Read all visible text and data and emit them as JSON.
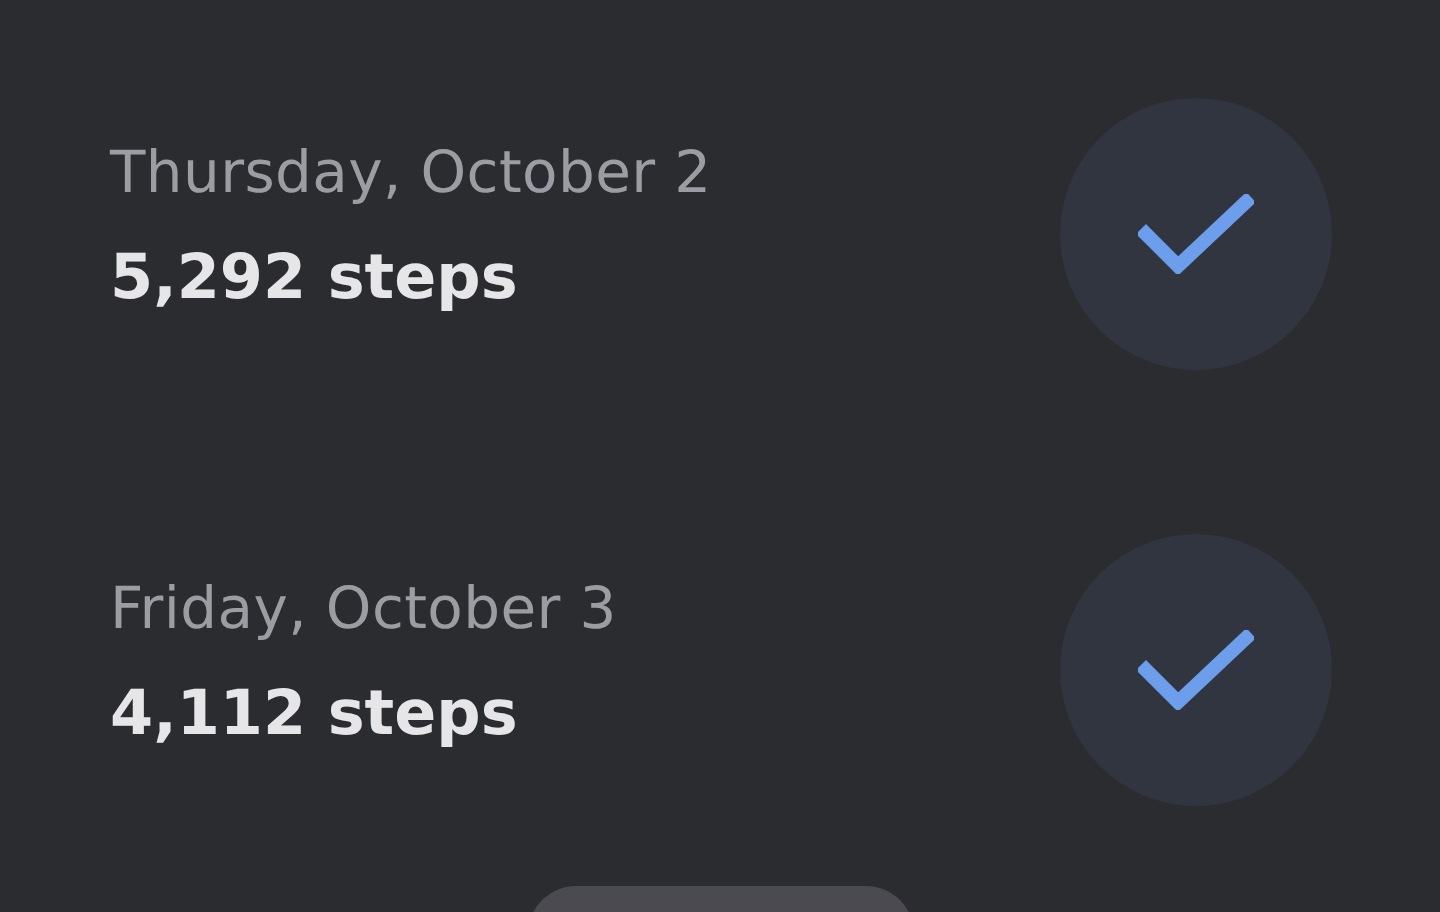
{
  "days": [
    {
      "date": "Thursday, October 2",
      "steps": "5,292 steps",
      "checked": true
    },
    {
      "date": "Friday, October 3",
      "steps": "4,112 steps",
      "checked": true
    }
  ]
}
